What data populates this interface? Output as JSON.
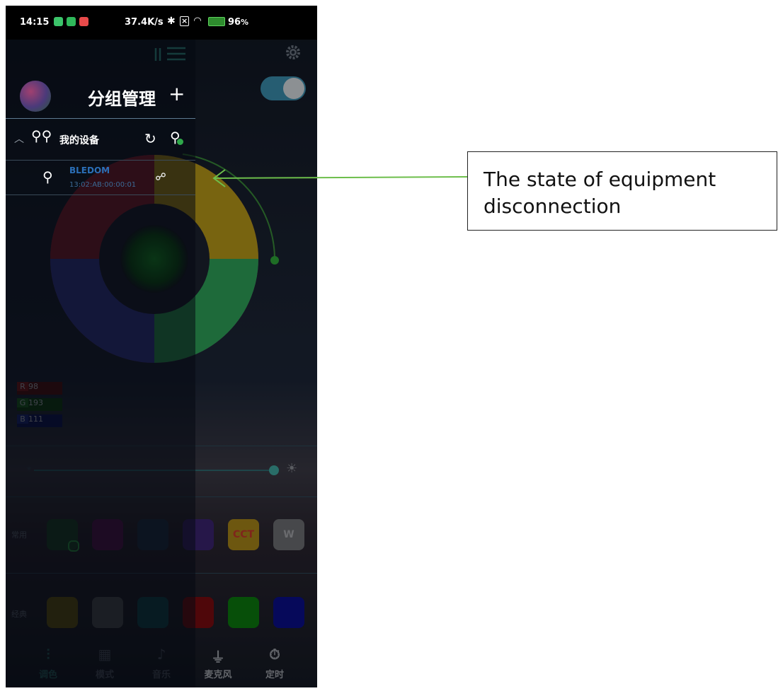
{
  "status_bar": {
    "time": "14:15",
    "speed": "37.4K/s",
    "battery": "96"
  },
  "drawer": {
    "title": "分组管理",
    "add_symbol": "+",
    "group": {
      "name": "我的设备"
    },
    "device": {
      "name": "BLEDOM",
      "mac": "13:02:AB:00:00:01"
    }
  },
  "color_values": {
    "r_label": "R",
    "r": "98",
    "g_label": "G",
    "g": "193",
    "b_label": "B",
    "b": "111"
  },
  "presets": {
    "common_label": "常用",
    "classic_label": "经典",
    "cct_label": "CCT",
    "w_label": "W"
  },
  "bottom_nav": [
    {
      "label": "调色",
      "icon": "sliders-icon"
    },
    {
      "label": "模式",
      "icon": "grid-icon"
    },
    {
      "label": "音乐",
      "icon": "music-icon"
    },
    {
      "label": "麦克风",
      "icon": "microphone-icon"
    },
    {
      "label": "定时",
      "icon": "timer-icon"
    }
  ],
  "annotation": {
    "text": "The state of equipment disconnection"
  },
  "colors": {
    "accent": "#4fc2b0",
    "callout_arrow": "#6dbe4b"
  }
}
